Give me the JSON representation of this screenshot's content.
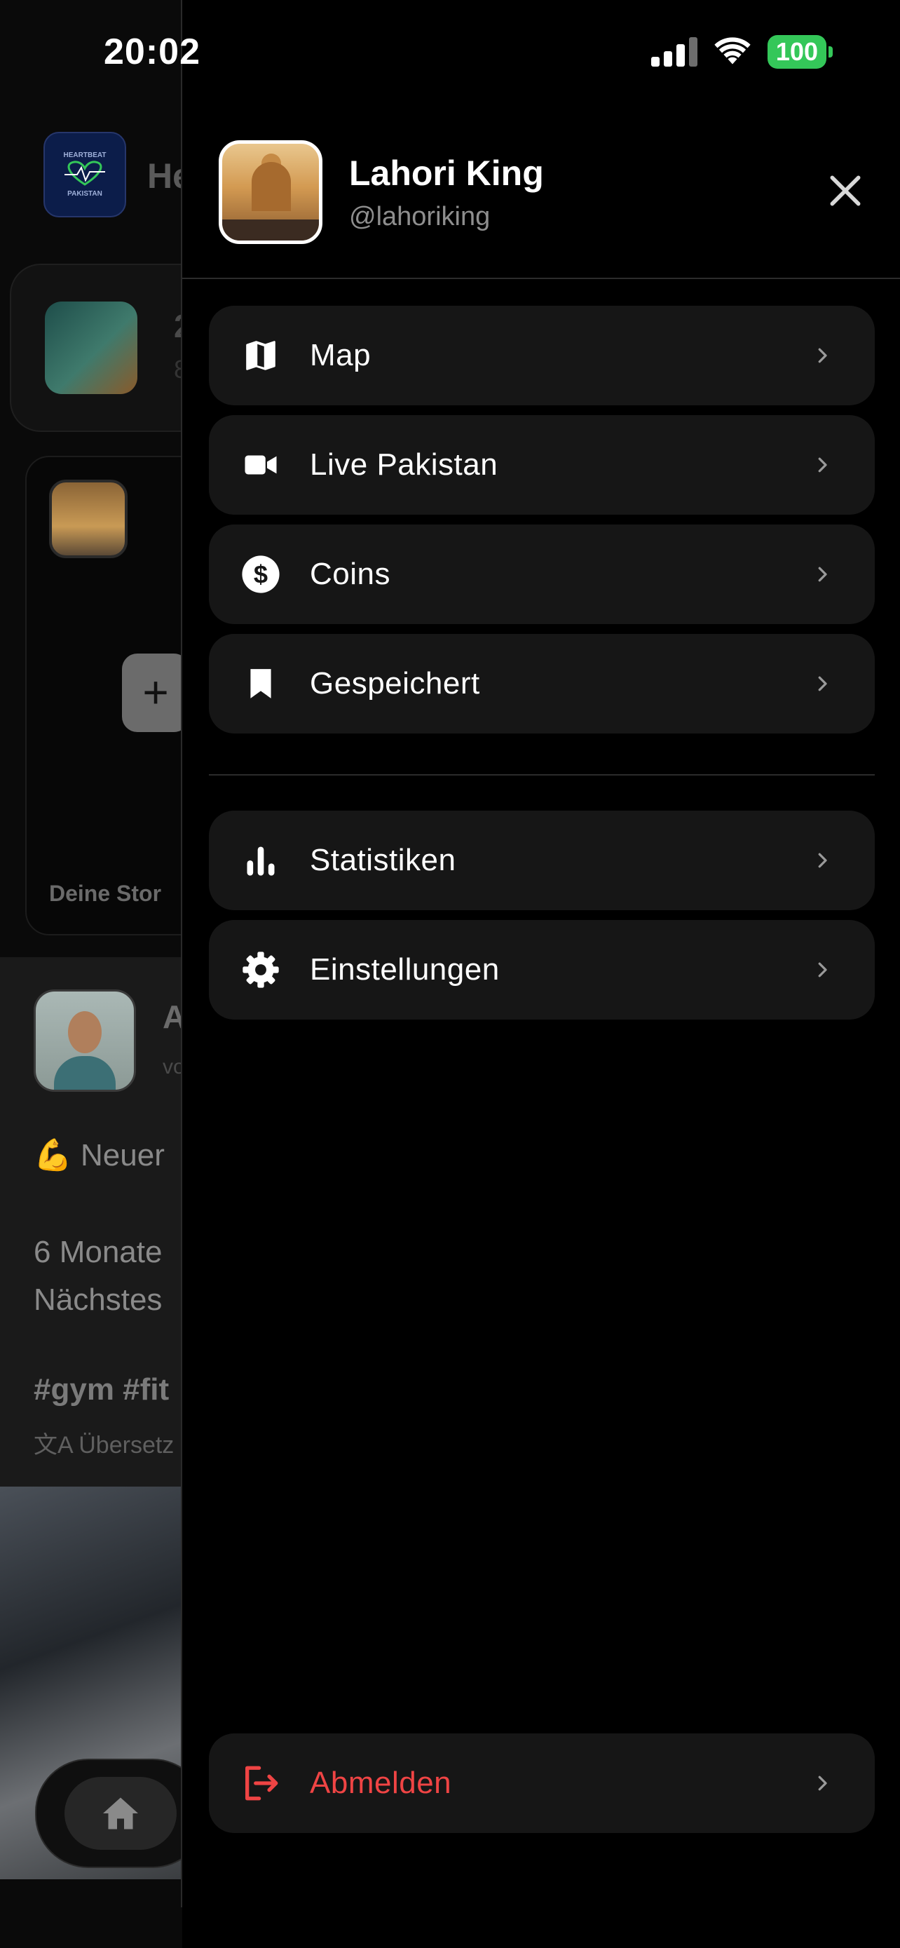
{
  "status_bar": {
    "time": "20:02",
    "battery": "100"
  },
  "background": {
    "logo_top": "HEARTBEAT",
    "logo_bottom": "PAKISTAN",
    "title_partial": "He",
    "card_number_partial": "2",
    "card_sub_partial": "8",
    "story_label_partial": "Deine Stor",
    "post_name_partial": "A",
    "post_meta_partial": "vo",
    "post_line1": "💪 Neuer",
    "post_line2": "6 Monate",
    "post_line3": "Nächstes",
    "post_tags_partial": "#gym #fit",
    "translate_partial": "Übersetz"
  },
  "drawer": {
    "profile": {
      "name": "Lahori King",
      "handle": "@lahoriking"
    },
    "menu": [
      {
        "label": "Map",
        "icon": "map-icon"
      },
      {
        "label": "Live Pakistan",
        "icon": "video-camera-icon"
      },
      {
        "label": "Coins",
        "icon": "dollar-coin-icon"
      },
      {
        "label": "Gespeichert",
        "icon": "bookmark-icon"
      }
    ],
    "secondary": [
      {
        "label": "Statistiken",
        "icon": "bar-chart-icon"
      },
      {
        "label": "Einstellungen",
        "icon": "gear-icon"
      }
    ],
    "logout": {
      "label": "Abmelden",
      "icon": "logout-icon"
    }
  },
  "colors": {
    "accent_danger": "#ef4444",
    "battery_green": "#34c759",
    "item_bg": "#161616"
  }
}
